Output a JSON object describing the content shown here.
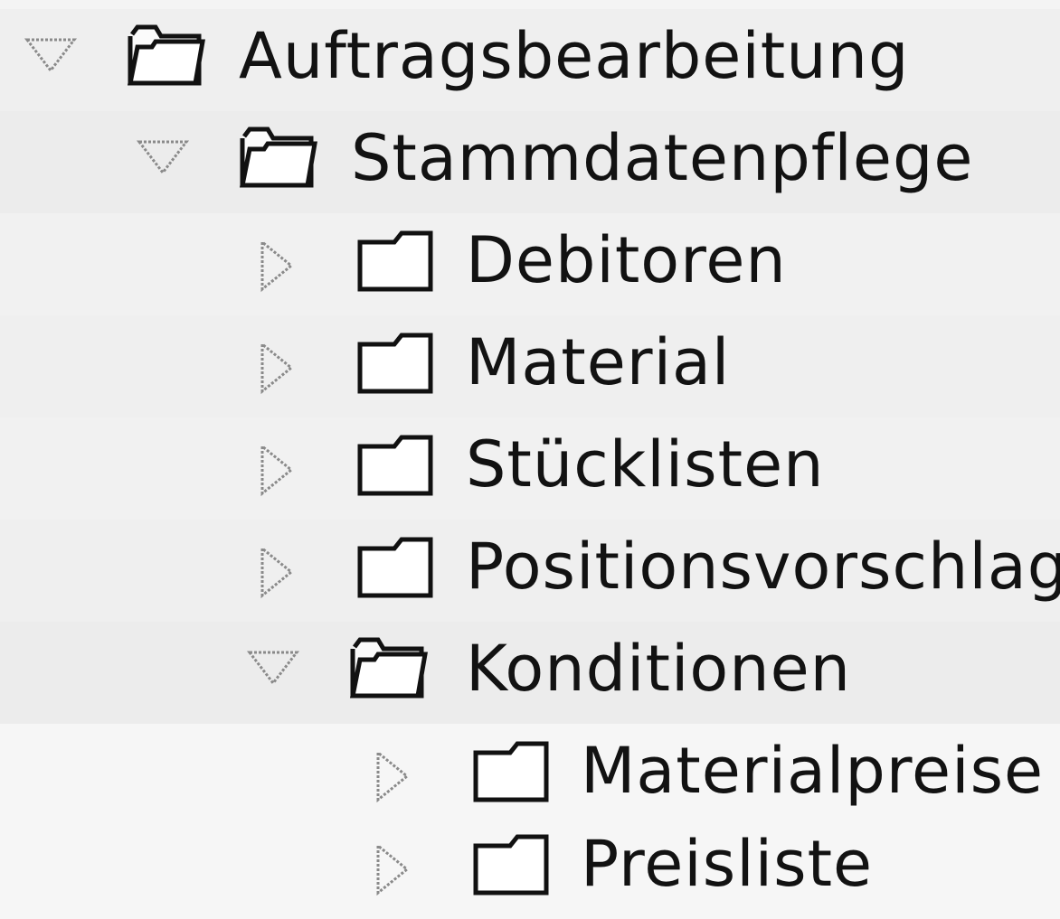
{
  "tree": {
    "nodes": [
      {
        "label": "Auftragsbearbeitung",
        "expanded": true,
        "icon": "folder-open-icon"
      },
      {
        "label": "Stammdatenpflege",
        "expanded": true,
        "icon": "folder-open-icon"
      },
      {
        "label": "Debitoren",
        "expanded": false,
        "icon": "folder-closed-icon"
      },
      {
        "label": "Material",
        "expanded": false,
        "icon": "folder-closed-icon"
      },
      {
        "label": "Stücklisten",
        "expanded": false,
        "icon": "folder-closed-icon"
      },
      {
        "label": "Positionsvorschlag",
        "expanded": false,
        "icon": "folder-closed-icon"
      },
      {
        "label": "Konditionen",
        "expanded": true,
        "icon": "folder-open-icon"
      },
      {
        "label": "Materialpreise",
        "expanded": false,
        "icon": "folder-closed-icon"
      },
      {
        "label": "Preisliste",
        "expanded": false,
        "icon": "folder-closed-icon"
      }
    ]
  }
}
